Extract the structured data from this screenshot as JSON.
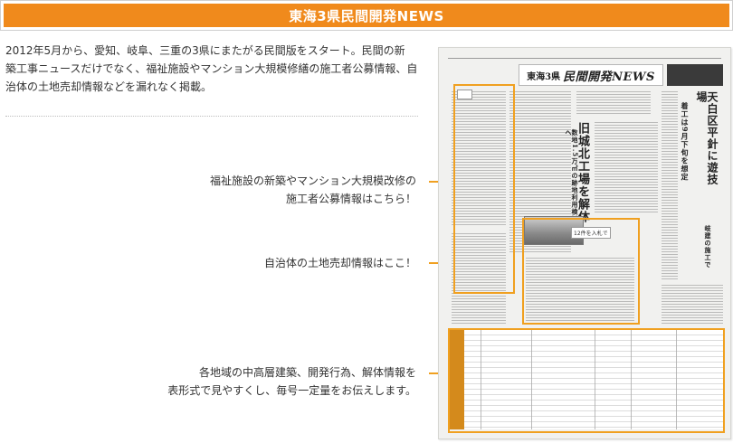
{
  "header": {
    "title": "東海3県民間開発NEWS"
  },
  "intro": {
    "lines": [
      "2012年5月から、愛知、岐阜、三重の3県にまたがる民間版をスタート。民間の新",
      "築工事ニュースだけでなく、福祉施設やマンション大規模修繕の施工者公募情報、自",
      "治体の土地売却情報などを漏れなく掲載。"
    ]
  },
  "callouts": [
    {
      "lines": [
        "福祉施設の新築やマンション大規模改修の",
        "施工者公募情報はこちら！"
      ]
    },
    {
      "lines": [
        "自治体の土地売却情報はここ！"
      ]
    },
    {
      "lines": [
        "各地域の中高層建築、開発行為、解体情報を",
        "表形式で見やすくし、毎号一定量をお伝えします。"
      ]
    }
  ],
  "newspaper": {
    "masthead_prefix": "東海3県",
    "masthead_title": "民間開発NEWS",
    "headline_right": "天白区平針に遊技場",
    "subhead_right": "着工は9月下旬を想定",
    "headline_center": "旧城北工場を解体",
    "subhead_center": "数地1.5万㎡の跡地利用検討へ",
    "headline_lower_right": "岐建の施工で",
    "box_label": "12件を入札で",
    "accent_color": "#f0a020",
    "header_color": "#f08a1c"
  }
}
